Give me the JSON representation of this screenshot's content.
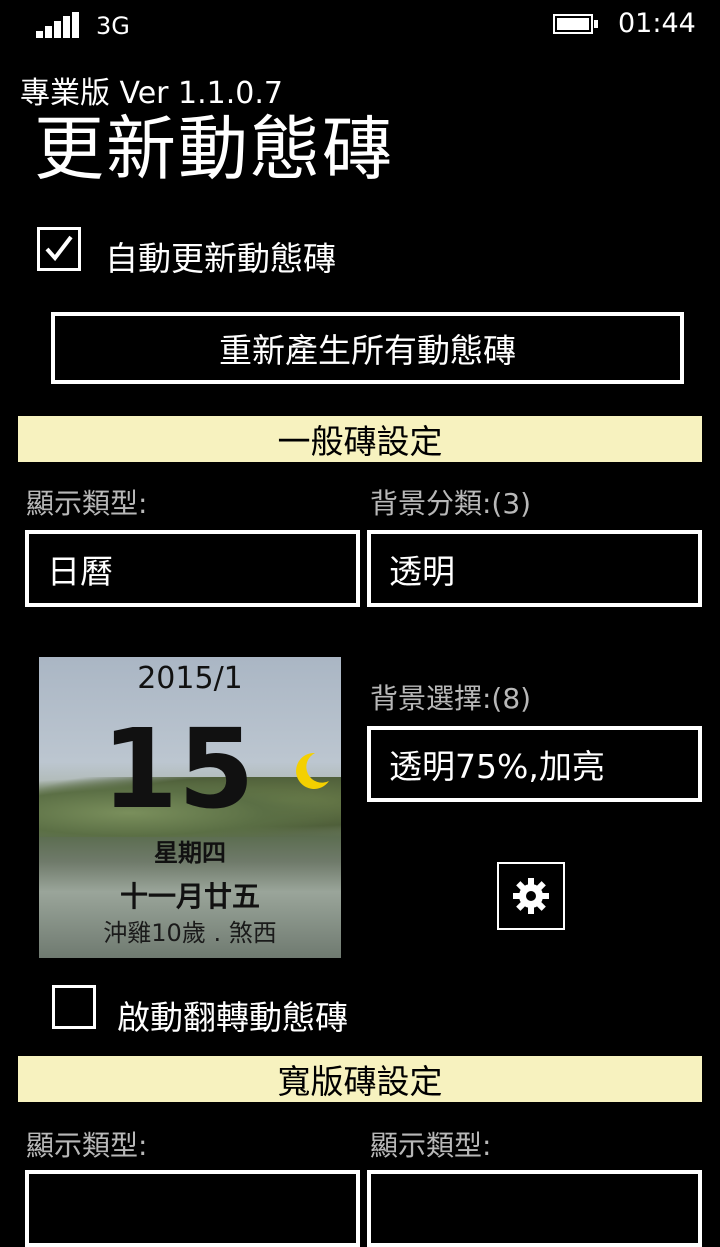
{
  "status": {
    "network": "3G",
    "time": "01:44"
  },
  "header": {
    "version": "專業版 Ver 1.1.0.7",
    "title": "更新動態磚"
  },
  "auto_update": {
    "label": "自動更新動態磚",
    "checked": true
  },
  "regenerate_button": "重新產生所有動態磚",
  "general": {
    "heading": "一般磚設定",
    "display_type_label": "顯示類型:",
    "display_type_value": "日曆",
    "bg_category_label": "背景分類:(3)",
    "bg_category_value": "透明",
    "bg_select_label": "背景選擇:(8)",
    "bg_select_value": "透明75%,加亮",
    "flip_label": "啟動翻轉動態磚",
    "flip_checked": false
  },
  "tile": {
    "year_month": "2015/1",
    "day": "15",
    "weekday": "星期四",
    "lunar": "十一月廿五",
    "extra": "沖雞10歲 . 煞西",
    "moon_icon": "crescent-moon-icon"
  },
  "wide": {
    "heading": "寬版磚設定",
    "display_type_label_1": "顯示類型:",
    "display_type_label_2": "顯示類型:"
  },
  "colors": {
    "section_bg": "#f7f2bf",
    "moon": "#f4d000"
  }
}
